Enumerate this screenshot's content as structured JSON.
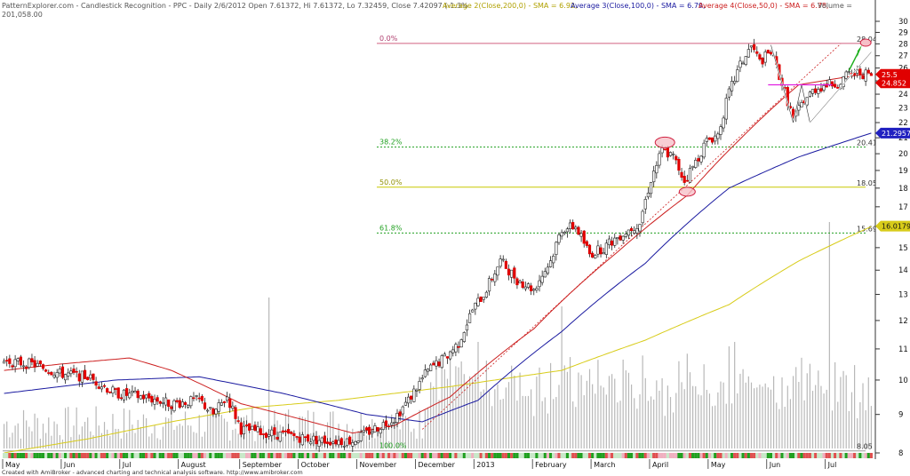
{
  "header": {
    "line1_left": "PatternExplorer.com - Candlestick Recognition - PPC - Daily 2/6/2012 Open 7.61372, Hi 7.61372, Lo 7.32459, Close 7.42097 (-1.3%",
    "line2_left": "201,058.00",
    "sma200_label": "Average 2(Close,200,0) - SMA = 6.92,",
    "sma100_label": "Average 3(Close,100,0) - SMA = 6.79,",
    "sma50_label": "Average 4(Close,50,0) - SMA = 6.78,",
    "volume_label": "Volume ="
  },
  "footer": {
    "credit": "Created with AmiBroker - advanced charting and technical analysis software. http://www.amibroker.com"
  },
  "colors": {
    "up": "#ffffff",
    "down": "#e00000",
    "sma50": "#cc2020",
    "sma100": "#1a1aa0",
    "sma200": "#d8cc1a",
    "fib_top": "#d06080",
    "fib_green": "#20a020",
    "fib_yellow": "#c8c800",
    "volume": "#b8b8b8"
  },
  "chart_data": {
    "type": "candlestick",
    "ylim": [
      8,
      30
    ],
    "y_scale": "log",
    "y_ticks": [
      8,
      9,
      10,
      11,
      12,
      13,
      14,
      15,
      16,
      17,
      18,
      19,
      20,
      21,
      22,
      23,
      24,
      25,
      26,
      27,
      28,
      29,
      30
    ],
    "month_labels": [
      "May",
      "Jun",
      "Jul",
      "August",
      "September",
      "October",
      "November",
      "December",
      "2013",
      "February",
      "March",
      "April",
      "May",
      "Jun",
      "Jul"
    ],
    "month_positions": [
      0,
      21,
      42,
      63,
      85,
      106,
      127,
      148,
      169,
      190,
      211,
      232,
      253,
      274,
      295
    ],
    "n_bars": 312,
    "fib_levels": [
      {
        "pct": "0.0%",
        "value": 28.04,
        "label": "28.04"
      },
      {
        "pct": "38.2%",
        "value": 20.41,
        "label": "20.41"
      },
      {
        "pct": "50.0%",
        "value": 18.05,
        "label": "18.05"
      },
      {
        "pct": "61.8%",
        "value": 15.69,
        "label": "15.69"
      },
      {
        "pct": "100.0%",
        "value": 8.05,
        "label": "8.05"
      }
    ],
    "price_tags": [
      {
        "value": 25.5,
        "label": "25.5",
        "color": "#e00000"
      },
      {
        "value": 24.85,
        "label": "24.852",
        "color": "#e00000"
      },
      {
        "value": 21.3,
        "label": "21.2957",
        "color": "#2020c0"
      },
      {
        "value": 16.02,
        "label": "16.0179",
        "color": "#d8cc1a"
      }
    ],
    "close_anchors": [
      [
        0,
        10.6
      ],
      [
        10,
        10.5
      ],
      [
        20,
        10.2
      ],
      [
        30,
        10.1
      ],
      [
        40,
        9.6
      ],
      [
        50,
        9.5
      ],
      [
        60,
        9.3
      ],
      [
        70,
        9.4
      ],
      [
        75,
        9.0
      ],
      [
        80,
        9.5
      ],
      [
        85,
        8.6
      ],
      [
        95,
        8.5
      ],
      [
        105,
        8.4
      ],
      [
        115,
        8.3
      ],
      [
        125,
        8.3
      ],
      [
        135,
        8.7
      ],
      [
        140,
        8.9
      ],
      [
        145,
        9.4
      ],
      [
        152,
        10.3
      ],
      [
        158,
        10.7
      ],
      [
        163,
        11.2
      ],
      [
        168,
        12.4
      ],
      [
        172,
        13.0
      ],
      [
        178,
        14.4
      ],
      [
        184,
        13.6
      ],
      [
        190,
        13.2
      ],
      [
        196,
        14.4
      ],
      [
        200,
        15.9
      ],
      [
        205,
        16.0
      ],
      [
        210,
        14.7
      ],
      [
        215,
        15.0
      ],
      [
        220,
        15.5
      ],
      [
        228,
        16.2
      ],
      [
        232,
        18.5
      ],
      [
        236,
        20.2
      ],
      [
        240,
        19.8
      ],
      [
        244,
        18.4
      ],
      [
        248,
        19.5
      ],
      [
        252,
        20.8
      ],
      [
        256,
        21.2
      ],
      [
        260,
        24.1
      ],
      [
        264,
        26.2
      ],
      [
        268,
        27.8
      ],
      [
        271,
        26.5
      ],
      [
        275,
        27.3
      ],
      [
        279,
        24.8
      ],
      [
        283,
        22.2
      ],
      [
        287,
        23.6
      ],
      [
        291,
        24.4
      ],
      [
        295,
        24.7
      ],
      [
        299,
        24.8
      ],
      [
        303,
        25.5
      ],
      [
        307,
        25.6
      ],
      [
        311,
        25.4
      ]
    ],
    "sma50_anchors": [
      [
        0,
        10.3
      ],
      [
        20,
        10.5
      ],
      [
        45,
        10.7
      ],
      [
        60,
        10.3
      ],
      [
        85,
        9.3
      ],
      [
        105,
        8.9
      ],
      [
        125,
        8.5
      ],
      [
        140,
        8.7
      ],
      [
        160,
        9.5
      ],
      [
        190,
        11.7
      ],
      [
        220,
        14.8
      ],
      [
        245,
        17.6
      ],
      [
        265,
        21.1
      ],
      [
        285,
        24.7
      ],
      [
        311,
        25.6
      ]
    ],
    "sma100_anchors": [
      [
        0,
        9.6
      ],
      [
        40,
        10.0
      ],
      [
        70,
        10.1
      ],
      [
        100,
        9.6
      ],
      [
        130,
        9.0
      ],
      [
        150,
        8.8
      ],
      [
        170,
        9.4
      ],
      [
        200,
        11.6
      ],
      [
        230,
        14.3
      ],
      [
        260,
        18.0
      ],
      [
        285,
        19.8
      ],
      [
        311,
        21.3
      ]
    ],
    "sma200_anchors": [
      [
        0,
        8.0
      ],
      [
        30,
        8.35
      ],
      [
        60,
        8.8
      ],
      [
        90,
        9.2
      ],
      [
        120,
        9.4
      ],
      [
        160,
        9.8
      ],
      [
        200,
        10.3
      ],
      [
        230,
        11.3
      ],
      [
        260,
        12.6
      ],
      [
        285,
        14.4
      ],
      [
        311,
        16.0
      ]
    ]
  }
}
